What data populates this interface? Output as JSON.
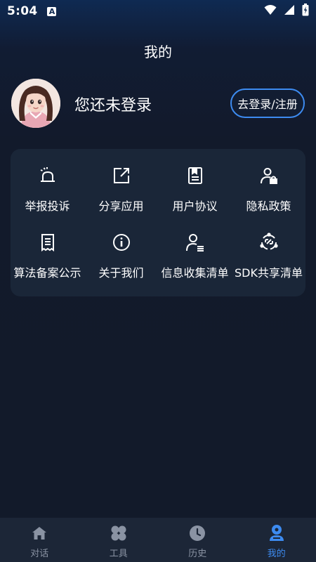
{
  "status_bar": {
    "time": "5:04",
    "badge": "A"
  },
  "header": {
    "title": "我的"
  },
  "profile": {
    "status_text": "您还未登录",
    "login_label": "去登录/注册"
  },
  "menu": {
    "items": [
      {
        "label": "举报投诉",
        "icon": "alarm-siren-icon"
      },
      {
        "label": "分享应用",
        "icon": "share-external-icon"
      },
      {
        "label": "用户协议",
        "icon": "document-icon"
      },
      {
        "label": "隐私政策",
        "icon": "user-lock-icon"
      },
      {
        "label": "算法备案公示",
        "icon": "receipt-icon"
      },
      {
        "label": "关于我们",
        "icon": "info-icon"
      },
      {
        "label": "信息收集清单",
        "icon": "user-list-icon"
      },
      {
        "label": "SDK共享清单",
        "icon": "sdk-link-icon"
      }
    ]
  },
  "tabbar": {
    "tabs": [
      {
        "label": "对话",
        "icon": "home-icon",
        "active": false
      },
      {
        "label": "工具",
        "icon": "tools-icon",
        "active": false
      },
      {
        "label": "历史",
        "icon": "clock-icon",
        "active": false
      },
      {
        "label": "我的",
        "icon": "profile-icon",
        "active": true
      }
    ]
  },
  "colors": {
    "accent": "#3d8bf0",
    "card": "#1a2638",
    "background": "#121a2a",
    "tab_inactive": "#8a93a3"
  }
}
